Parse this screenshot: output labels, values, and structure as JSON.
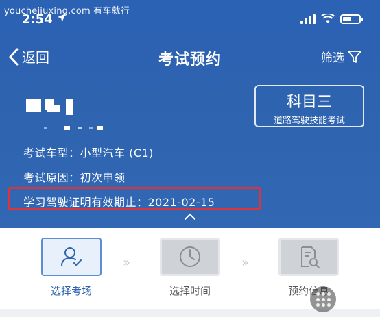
{
  "watermark": "youchejiuxing.com 有车就行",
  "status_bar": {
    "time": "2:54"
  },
  "nav": {
    "back_label": "返回",
    "title": "考试预约",
    "filter_label": "筛选"
  },
  "subject": {
    "main": "科目三",
    "sub": "道路驾驶技能考试"
  },
  "info": {
    "vehicle_type": "考试车型：小型汽车 (C1)",
    "exam_reason": "考试原因：初次申领",
    "permit_expiry": "学习驾驶证明有效期止：2021-02-15"
  },
  "steps": [
    {
      "label": "选择考场",
      "icon": "user-check-icon",
      "active": true
    },
    {
      "label": "选择时间",
      "icon": "clock-icon",
      "active": false
    },
    {
      "label": "预约信息",
      "icon": "document-search-icon",
      "active": false
    }
  ],
  "colors": {
    "header_blue": "#2f63b2",
    "highlight_red": "#d8363c",
    "active_step": "#5a8fd5"
  }
}
